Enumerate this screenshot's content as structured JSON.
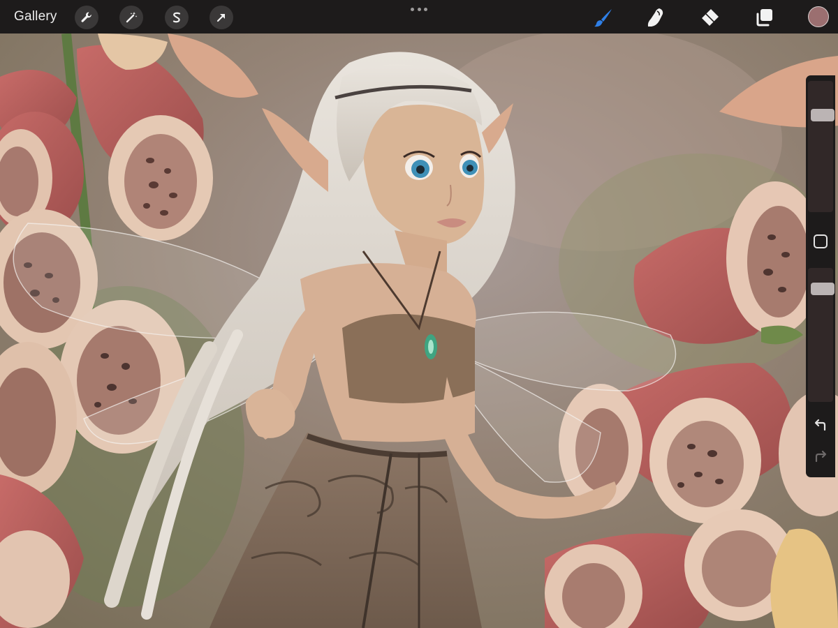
{
  "toolbar": {
    "gallery_label": "Gallery",
    "left_tools": [
      {
        "name": "actions",
        "icon": "wrench-icon"
      },
      {
        "name": "adjustments",
        "icon": "magic-wand-icon"
      },
      {
        "name": "selection",
        "icon": "selection-s-icon"
      },
      {
        "name": "transform",
        "icon": "arrow-cursor-icon"
      }
    ],
    "center_menu_icon": "more-dots-icon",
    "right_tools": [
      {
        "name": "brush",
        "icon": "brush-icon",
        "active": true
      },
      {
        "name": "smudge",
        "icon": "smudge-finger-icon",
        "active": false
      },
      {
        "name": "eraser",
        "icon": "eraser-icon",
        "active": false
      },
      {
        "name": "layers",
        "icon": "layers-icon",
        "active": false
      }
    ],
    "current_color": "#9b6f70"
  },
  "sidebar": {
    "brush_size_level": 0.78,
    "opacity_level": 0.9,
    "modify_button_icon": "square-icon",
    "undo_icon": "undo-arrow-icon",
    "redo_icon": "redo-arrow-icon"
  },
  "colors": {
    "accent_brush": "#2f7fe6",
    "toolbar_bg": "#1d1b1b"
  }
}
